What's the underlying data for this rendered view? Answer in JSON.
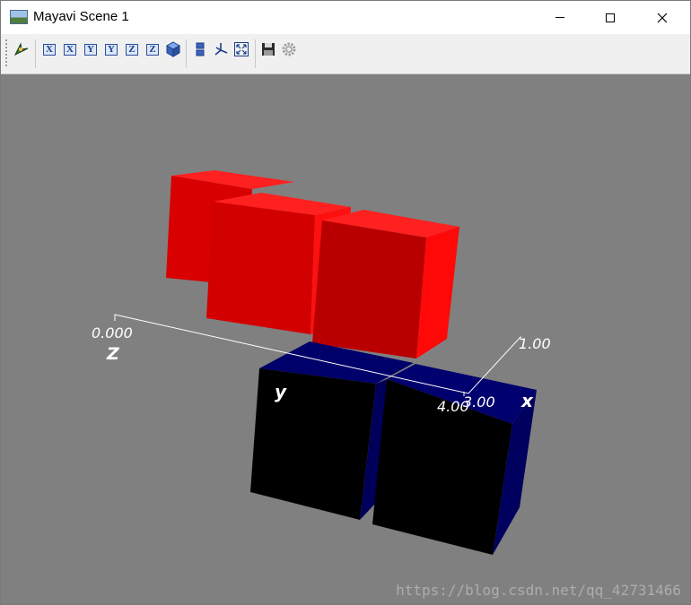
{
  "window": {
    "title": "Mayavi Scene 1"
  },
  "toolbar": {
    "buttons": [
      {
        "name": "mayavi-pipeline-icon"
      },
      {
        "name": "view-x-plus-icon",
        "glyph": "X"
      },
      {
        "name": "view-x-minus-icon",
        "glyph": "X"
      },
      {
        "name": "view-y-plus-icon",
        "glyph": "Y"
      },
      {
        "name": "view-y-minus-icon",
        "glyph": "Y"
      },
      {
        "name": "view-z-plus-icon",
        "glyph": "Z"
      },
      {
        "name": "view-z-minus-icon",
        "glyph": "Z"
      },
      {
        "name": "isometric-view-icon"
      },
      {
        "name": "parallel-projection-icon"
      },
      {
        "name": "axes-indicator-icon"
      },
      {
        "name": "full-screen-icon"
      },
      {
        "name": "save-icon"
      },
      {
        "name": "configure-icon"
      }
    ]
  },
  "scene": {
    "colors": {
      "background": "#808080",
      "red_boxes": "#ff0000",
      "blue_boxes": "#000066",
      "axis_text": "#ffffff"
    },
    "axes": {
      "z_label": "Z",
      "y_label": "y",
      "x_label": "x",
      "z_tick": "0.000",
      "x_tick_a": "4.00",
      "x_tick_b": "3.00",
      "x_tick_c": "1.00"
    }
  },
  "watermark": "https://blog.csdn.net/qq_42731466"
}
